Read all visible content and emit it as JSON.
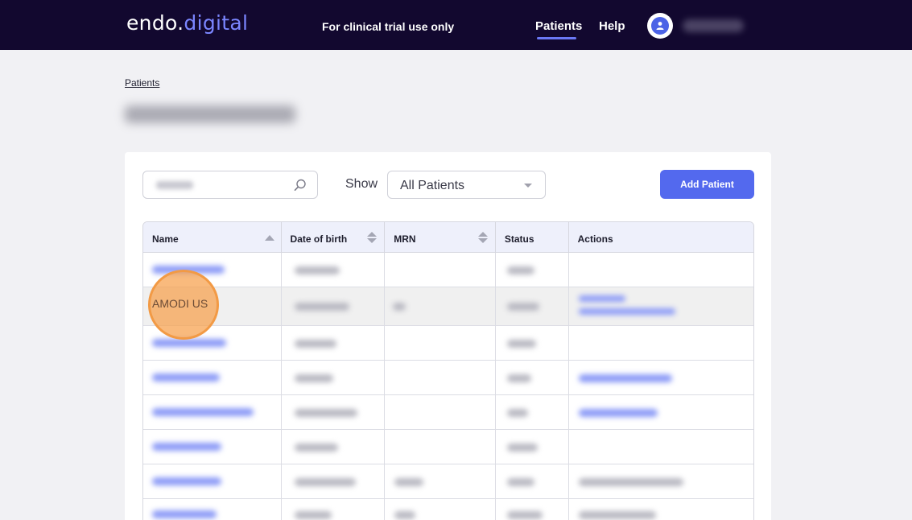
{
  "header": {
    "logo_part1": "endo.",
    "logo_part2": "digital",
    "notice": "For clinical trial use only",
    "nav": [
      {
        "label": "Patients",
        "active": true
      },
      {
        "label": "Help",
        "active": false
      }
    ],
    "accent_color": "#5369ee",
    "bar_color": "#12082f"
  },
  "breadcrumb": {
    "label": "Patients"
  },
  "toolbar": {
    "show_label": "Show",
    "filter_value": "All Patients",
    "add_button_label": "Add Patient"
  },
  "table": {
    "columns": [
      "Name",
      "Date of birth",
      "MRN",
      "Status",
      "Actions"
    ],
    "highlighted_row_name": "AMODI US"
  },
  "icons": {
    "search": "search-icon",
    "avatar": "user-avatar-icon",
    "dropdown": "chevron-down-icon",
    "sort": "sort-icon"
  }
}
